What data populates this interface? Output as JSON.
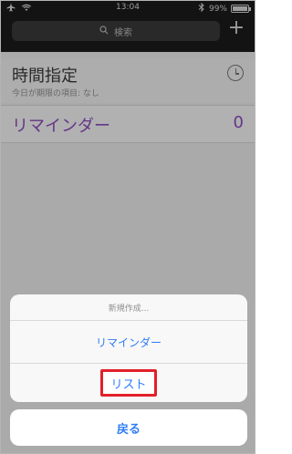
{
  "statusbar": {
    "time": "13:04",
    "battery_text": "99%"
  },
  "search": {
    "placeholder": "検索"
  },
  "lists": [
    {
      "title": "時間指定",
      "subtitle": "今日が期限の項目: なし"
    },
    {
      "title": "リマインダー",
      "count": "0"
    }
  ],
  "action_sheet": {
    "title": "新規作成...",
    "items": [
      "リマインダー",
      "リスト"
    ],
    "cancel": "戻る"
  },
  "colors": {
    "accent": "#2f7df6",
    "list_purple": "#8b4bbd",
    "highlight_red": "#e2202a"
  },
  "icons": {
    "airplane": "airplane-icon",
    "wifi": "wifi-icon",
    "bluetooth": "bluetooth-icon",
    "search": "search-icon",
    "add": "plus-icon",
    "alarm": "alarm-clock-icon"
  }
}
